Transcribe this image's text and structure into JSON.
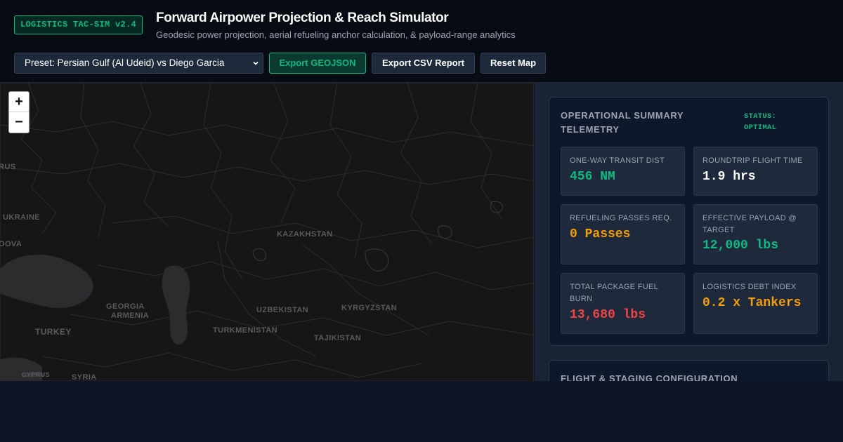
{
  "header": {
    "badge": "LOGISTICS TAC-SIM v2.4",
    "title": "Forward Airpower Projection & Reach Simulator",
    "subtitle": "Geodesic power projection, aerial refueling anchor calculation, & payload-range analytics"
  },
  "toolbar": {
    "preset_selected": "Preset: Persian Gulf (Al Udeid) vs Diego Garcia",
    "export_geojson_label": "Export GEOJSON",
    "export_csv_label": "Export CSV Report",
    "reset_map_label": "Reset Map"
  },
  "map": {
    "zoom_in_label": "+",
    "zoom_out_label": "−",
    "labels": {
      "belarus": "RUS",
      "ukraine": "UKRAINE",
      "moldova": "OOVA",
      "kazakhstan": "KAZAKHSTAN",
      "georgia": "GEORGIA",
      "armenia": "ARMENIA",
      "turkey": "TURKEY",
      "uzbekistan": "UZBEKISTAN",
      "kyrgyzstan": "KYRGYZSTAN",
      "turkmenistan": "TURKMENISTAN",
      "tajikistan": "TAJIKISTAN",
      "cyprus": "CYPRUS",
      "syria": "SYRIA"
    }
  },
  "summary": {
    "title": "OPERATIONAL SUMMARY TELEMETRY",
    "status": "STATUS: OPTIMAL",
    "metrics": [
      {
        "label": "ONE-WAY TRANSIT DIST",
        "value": "456 NM",
        "color": "#10b981"
      },
      {
        "label": "ROUNDTRIP FLIGHT TIME",
        "value": "1.9 hrs",
        "color": "#ffffff"
      },
      {
        "label": "REFUELING PASSES REQ.",
        "value": "0 Passes",
        "color": "#f59e0b"
      },
      {
        "label": "EFFECTIVE PAYLOAD @ TARGET",
        "value": "12,000 lbs",
        "color": "#10b981"
      },
      {
        "label": "TOTAL PACKAGE FUEL BURN",
        "value": "13,680 lbs",
        "color": "#ef4444"
      },
      {
        "label": "LOGISTICS DEBT INDEX",
        "value": "0.2 x Tankers",
        "color": "#f59e0b"
      }
    ]
  },
  "config": {
    "title": "FLIGHT & STAGING CONFIGURATION"
  },
  "colors": {
    "accent": "#10b981",
    "warning": "#f59e0b",
    "danger": "#ef4444"
  }
}
